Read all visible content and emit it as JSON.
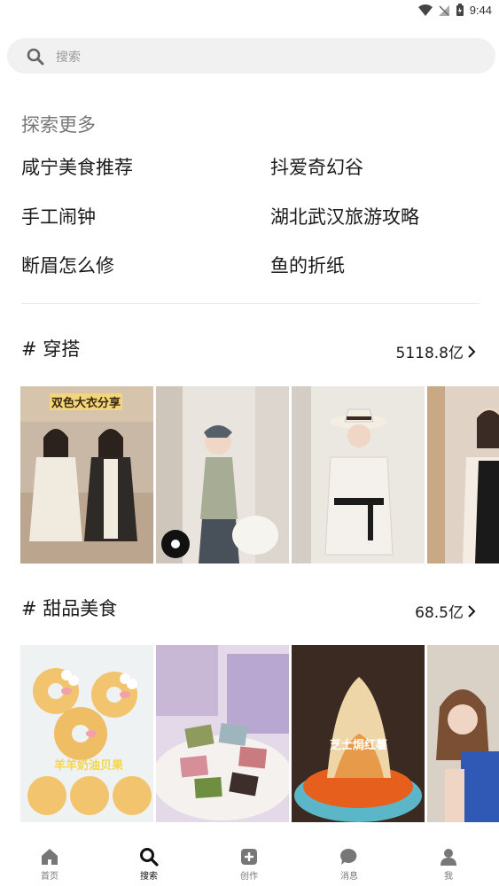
{
  "status": {
    "time": "9:44"
  },
  "search": {
    "placeholder": "搜索"
  },
  "explore": {
    "title": "探索更多",
    "items": [
      "咸宁美食推荐",
      "抖爱奇幻谷",
      "手工闹钟",
      "湖北武汉旅游攻略",
      "断眉怎么修",
      "鱼的折纸"
    ]
  },
  "sections": [
    {
      "title": "# 穿搭",
      "count": "5118.8亿",
      "thumb_captions": [
        "双色大衣分享"
      ]
    },
    {
      "title": "# 甜品美食",
      "count": "68.5亿",
      "thumb_captions": [
        "羊羊奶油贝果",
        "芝士焗红薯"
      ]
    }
  ],
  "tabs": [
    {
      "label": "首页",
      "icon": "home-icon"
    },
    {
      "label": "搜索",
      "icon": "search-icon"
    },
    {
      "label": "创作",
      "icon": "create-icon"
    },
    {
      "label": "消息",
      "icon": "message-icon"
    },
    {
      "label": "我",
      "icon": "profile-icon"
    }
  ],
  "colors": {
    "background": "#ffffff",
    "search_bg": "#f1f1f1",
    "text": "#1a1a1a",
    "muted": "#777777"
  }
}
